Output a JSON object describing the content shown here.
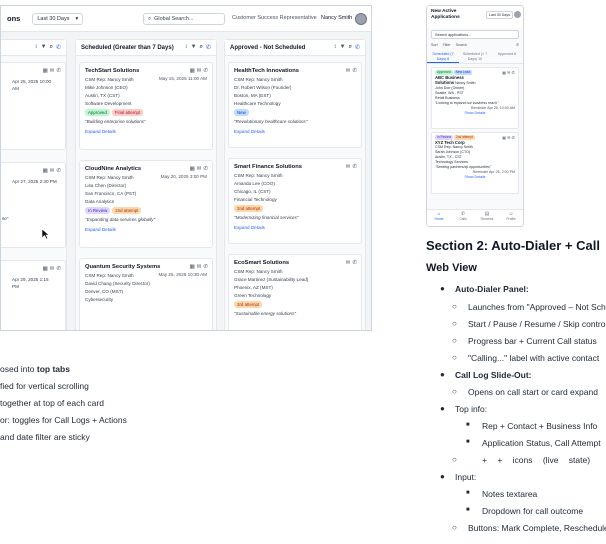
{
  "web": {
    "title": "ons",
    "date_filter": "Last 30 Days",
    "search_placeholder": "Global Search...",
    "role": "Customer Success Representative",
    "user": "Nancy Smith",
    "partial_col": {
      "label": "s",
      "cards": [
        {
          "date": "Apr 25, 2025 10:00",
          "extra": "AM"
        },
        {
          "date": "Apr 27, 2025 2:30 PM",
          "extra": ""
        },
        {
          "date": "Apr 29, 2025 1:15",
          "extra": "PM"
        }
      ],
      "stray_text": "se\""
    },
    "columns": [
      {
        "title": "Scheduled (Greater than 7 Days)",
        "cards": [
          {
            "name": "TechStart Solutions",
            "rep": "CSM Rep: Nancy Smith",
            "date": "May 15, 2025 11:00 AM",
            "contact": "Mike Johnson (CEO)",
            "location": "Austin, TX (CST)",
            "industry": "Software Development",
            "badges": [
              "Approved",
              "Final attempt"
            ],
            "quote": "\"Building enterprise solutions\"",
            "link": "Expand Details"
          },
          {
            "name": "CloudNine Analytics",
            "rep": "CSM Rep: Nancy Smith",
            "date": "May 20, 2025 3:00 PM",
            "contact": "Lisa Chen (Director)",
            "location": "San Francisco, CA (PST)",
            "industry": "Data Analytics",
            "badges": [
              "In Review",
              "2nd attempt"
            ],
            "quote": "\"Expanding data services globally\"",
            "link": "Expand Details"
          },
          {
            "name": "Quantum Security Systems",
            "rep": "CSM Rep: Nancy Smith",
            "date": "May 25, 2025 10:30 AM",
            "contact": "David Chang (Security Director)",
            "location": "Denver, CO (MST)",
            "industry": "Cybersecurity"
          }
        ]
      },
      {
        "title": "Approved - Not Scheduled",
        "cards": [
          {
            "name": "HealthTech Innovations",
            "rep": "CSM Rep: Nancy Smith",
            "contact": "Dr. Robert Wilson (Founder)",
            "location": "Boston, MA (EST)",
            "industry": "Healthcare Technology",
            "badges": [
              "New"
            ],
            "quote": "\"Revolutionary healthcare solutions\"",
            "link": "Expand Details"
          },
          {
            "name": "Smart Finance Solutions",
            "rep": "CSM Rep: Nancy Smith",
            "contact": "Amanda Lee (COO)",
            "location": "Chicago, IL (CST)",
            "industry": "Financial Technology",
            "badges": [
              "2nd attempt"
            ],
            "quote": "\"Modernizing financial services\"",
            "link": "Expand Details"
          },
          {
            "name": "EcoSmart Solutions",
            "rep": "CSM Rep: Nancy Smith",
            "contact": "Grace Martinez (Sustainability Lead)",
            "location": "Phoenix, AZ (MST)",
            "industry": "Green Technology",
            "badges": [
              "3rd attempt"
            ],
            "quote": "\"Sustainable energy solutions\""
          }
        ]
      }
    ]
  },
  "mobile": {
    "title_line1": "New Active",
    "title_line2": "Applications",
    "date_filter": "Last 30 Days",
    "search_placeholder": "Search applications...",
    "tools": [
      "Sort",
      "Filter",
      "Search"
    ],
    "tabs": [
      "Scheduled (7 Days) 8",
      "Scheduled (> 7 Days) 10",
      "Approved 6"
    ],
    "cards": [
      {
        "badges": [
          "Approved",
          "New Lead"
        ],
        "name": "ABC Business",
        "sub": "Solutions",
        "rep_short": "Nancy Smith",
        "contact": "John Doe (Owner)",
        "location": "Seattle, WA - PST",
        "industry": "Retail Business",
        "quote": "\"Looking to expand our business reach\"",
        "time": "Reminder Apr 25, 10:00 AM",
        "show": "Show Details"
      },
      {
        "badges": [
          "In Review",
          "2nd attempt"
        ],
        "name": "XYZ Tech Corp",
        "rep": "CSM Rep: Nancy Smith",
        "contact": "Sarah Johnson (CTO)",
        "location": "Austin, TX - CST",
        "industry": "Technology Services",
        "quote": "\"Seeking partnership opportunities\"",
        "time": "Reminder Apr 26, 2:00 PM",
        "show": "Show Details"
      }
    ],
    "nav": [
      "Home",
      "Calls",
      "Reviews",
      "Profile"
    ]
  },
  "doc_right": {
    "section_heading": "Section 2: Auto-Dialer + Call",
    "sub_heading": "Web View",
    "items": [
      {
        "level": 1,
        "text": "Auto-Dialer Panel:",
        "bold": true
      },
      {
        "level": 2,
        "text": "Launches from \"Approved – Not Sch"
      },
      {
        "level": 2,
        "text": "Start / Pause / Resume / Skip contro"
      },
      {
        "level": 2,
        "text": "Progress bar + Current Call status"
      },
      {
        "level": 2,
        "text": "\"Calling...\" label with active contact"
      },
      {
        "level": 1,
        "text": "Call Log Slide-Out:",
        "bold": true
      },
      {
        "level": 2,
        "text": "Opens on call start or card expand"
      },
      {
        "level": 1,
        "text": "Top info:"
      },
      {
        "level": 3,
        "text": "Rep + Contact + Business Info"
      },
      {
        "level": 3,
        "text": "Application Status, Call Attempt"
      },
      {
        "level": 2,
        "text": "+ + icons (live state)"
      },
      {
        "level": 1,
        "text": "Input:"
      },
      {
        "level": 3,
        "text": "Notes textarea"
      },
      {
        "level": 3,
        "text": "Dropdown for call outcome"
      },
      {
        "level": 2,
        "text": "Buttons: Mark Complete, Reschedule"
      }
    ]
  },
  "doc_left": {
    "line1_pre": "osed into ",
    "line1_bold": "top tabs",
    "line2": "fied for vertical scrolling",
    "line3": "together at top of each card",
    "line4": "or: toggles for Call Logs + Actions",
    "line5": "and date filter are sticky"
  }
}
